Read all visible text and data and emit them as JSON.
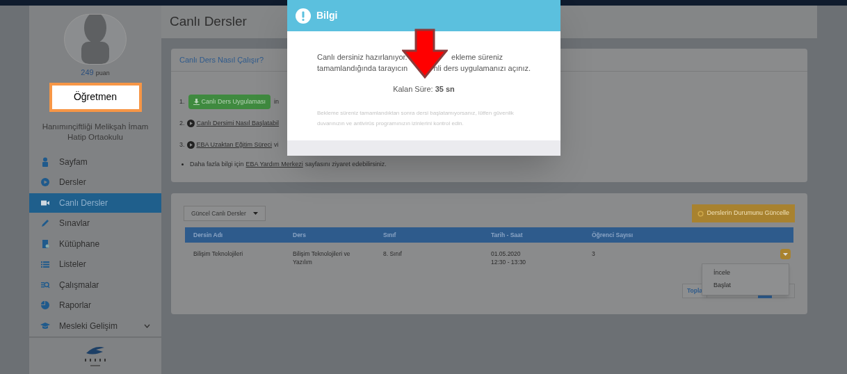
{
  "sidebar": {
    "points": "249",
    "points_label": "puan",
    "role": "Öğretmen",
    "school": "Hanımınçiftliği Melikşah İmam Hatip Ortaokulu",
    "items": [
      {
        "label": "Sayfam",
        "selected": false,
        "expandable": false
      },
      {
        "label": "Dersler",
        "selected": false,
        "expandable": false
      },
      {
        "label": "Canlı Dersler",
        "selected": true,
        "expandable": false
      },
      {
        "label": "Sınavlar",
        "selected": false,
        "expandable": false
      },
      {
        "label": "Kütüphane",
        "selected": false,
        "expandable": false
      },
      {
        "label": "Listeler",
        "selected": false,
        "expandable": false
      },
      {
        "label": "Çalışmalar",
        "selected": false,
        "expandable": false
      },
      {
        "label": "Raporlar",
        "selected": false,
        "expandable": false
      },
      {
        "label": "Mesleki Gelişim",
        "selected": false,
        "expandable": true
      }
    ]
  },
  "page_title": "Canlı Dersler",
  "help_card": {
    "title": "Canlı Ders Nasıl Çalışır?",
    "steps": [
      {
        "kind": "button",
        "number": "1.",
        "button": "Canlı Ders Uygulaması",
        "after": "in"
      },
      {
        "kind": "link",
        "number": "2.",
        "link": "Canlı Dersimi Nasıl Başlatabil"
      },
      {
        "kind": "link",
        "number": "3.",
        "link": "EBA Uzaktan Eğitim Süreci",
        "after": "vi"
      },
      {
        "kind": "bullet",
        "before": "Daha fazla bilgi için",
        "link": "EBA Yardım Merkezi",
        "after": "sayfasını ziyaret edebilirsiniz."
      }
    ]
  },
  "lessons": {
    "filter": "Güncel Canlı Dersler",
    "refresh_button": "Derslerin Durumunu Güncelle",
    "columns": [
      "Dersin Adı",
      "Ders",
      "Sınıf",
      "Tarih - Saat",
      "Öğrenci Sayısı"
    ],
    "rows": [
      {
        "cells": [
          [
            "Bilişim Teknolojileri"
          ],
          [
            "Bilişim Teknolojileri ve",
            "Yazılım"
          ],
          [
            "8. Sınıf"
          ],
          [
            "01.05.2020",
            "12:30 - 13:30"
          ],
          [
            "3"
          ]
        ]
      }
    ],
    "pagination": "Topla",
    "menu": [
      "İncele",
      "Başlat"
    ]
  },
  "modal": {
    "title": "Bilgi",
    "line_1": [
      "Canlı dersiniz hazırlanıyor.",
      "ekleme süreniz"
    ],
    "line_2": [
      "tamamlandığında tarayıcın",
      "nli ders uygulamanızı açınız."
    ],
    "remaining_label": "Kalan Süre:",
    "remaining_value": "35 sn",
    "note": "Bekleme süreniz tamamlandıktan sonra dersi başlatamıyorsanız, lütfen güvenlik duvarınızın ve antivirüs programınızın izinlerini kontrol edin."
  }
}
